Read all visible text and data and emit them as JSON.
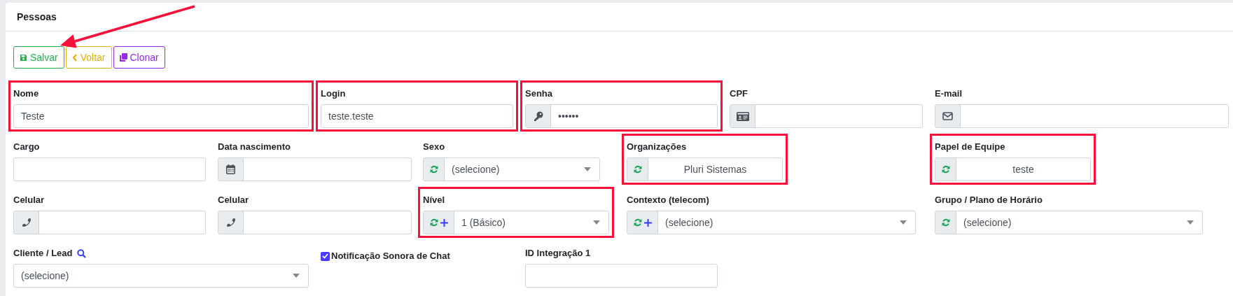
{
  "page_title": "Pessoas",
  "pointer_arrow": true,
  "buttons": [
    {
      "label": "Salvar",
      "color": "#1fb34a"
    },
    {
      "label": "Voltar",
      "color": "#e8b00c"
    },
    {
      "label": "Clonar",
      "color": "#9b28e8"
    }
  ],
  "rows": [
    [
      {
        "label": "Nome",
        "kind": "text",
        "value": "Teste",
        "highlighted": true
      },
      {
        "label": "Login",
        "kind": "text",
        "value": "teste.teste",
        "highlighted": true
      },
      {
        "label": "Senha",
        "kind": "password",
        "value": "••••••",
        "highlighted": true
      },
      {
        "label": "CPF",
        "kind": "document",
        "highlighted": false
      },
      {
        "label": "E-mail",
        "kind": "email",
        "highlighted": false
      }
    ],
    [
      {
        "label": "Cargo",
        "kind": "text",
        "highlighted": false
      },
      {
        "label": "Data nascimento",
        "kind": "date",
        "highlighted": false
      },
      {
        "label": "Sexo",
        "kind": "select",
        "value": "(selecione)",
        "highlighted": false
      },
      {
        "label": "Organizações",
        "kind": "display",
        "value": "Pluri Sistemas",
        "highlighted": true
      },
      {
        "label": "Papel de Equipe",
        "kind": "display",
        "value": "teste",
        "highlighted": true
      }
    ],
    [
      {
        "label": "Celular",
        "kind": "phone",
        "highlighted": false
      },
      {
        "label": "Celular",
        "kind": "phone",
        "highlighted": false
      },
      {
        "label": "Nível",
        "kind": "select-add",
        "value": "1 (Básico)",
        "highlighted": true
      },
      {
        "label": "Contexto (telecom)",
        "kind": "select-add",
        "value": "(selecione)",
        "highlighted": false
      },
      {
        "label": "Grupo / Plano de Horário",
        "kind": "select",
        "value": "(selecione)",
        "highlighted": false
      }
    ],
    [
      {
        "label": "Cliente / Lead",
        "kind": "lookup",
        "value": "(selecione)",
        "highlighted": false
      },
      {
        "label": "Notificação Sonora de Chat",
        "kind": "checkbox",
        "checked": true,
        "highlighted": false
      },
      {
        "label": "ID Integração 1",
        "kind": "text",
        "highlighted": false
      }
    ]
  ]
}
